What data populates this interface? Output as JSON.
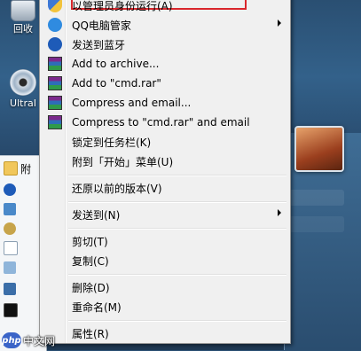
{
  "desktop": {
    "recycle_label": "回收",
    "ultra_label": "UltraI"
  },
  "start_menu": {
    "folder_label": "附"
  },
  "context_menu": {
    "items": [
      {
        "label": "以管理员身份运行(A)",
        "icon": "shield-icon",
        "submenu": false
      },
      {
        "label": "QQ电脑管家",
        "icon": "qq-icon",
        "submenu": true
      },
      {
        "label": "发送到蓝牙",
        "icon": "bluetooth-icon",
        "submenu": false
      },
      {
        "label": "Add to archive...",
        "icon": "winrar-icon",
        "submenu": false
      },
      {
        "label": "Add to \"cmd.rar\"",
        "icon": "winrar-icon",
        "submenu": false
      },
      {
        "label": "Compress and email...",
        "icon": "winrar-icon",
        "submenu": false
      },
      {
        "label": "Compress to \"cmd.rar\" and email",
        "icon": "winrar-icon",
        "submenu": false
      },
      {
        "label": "锁定到任务栏(K)",
        "icon": "",
        "submenu": false
      },
      {
        "label": "附到「开始」菜单(U)",
        "icon": "",
        "submenu": false
      },
      {
        "label": "还原以前的版本(V)",
        "icon": "",
        "submenu": false
      },
      {
        "label": "发送到(N)",
        "icon": "",
        "submenu": true
      },
      {
        "label": "剪切(T)",
        "icon": "",
        "submenu": false
      },
      {
        "label": "复制(C)",
        "icon": "",
        "submenu": false
      },
      {
        "label": "删除(D)",
        "icon": "",
        "submenu": false
      },
      {
        "label": "重命名(M)",
        "icon": "",
        "submenu": false
      },
      {
        "label": "属性(R)",
        "icon": "",
        "submenu": false
      }
    ]
  },
  "watermark": {
    "logo_text": "php",
    "text": "中文网"
  }
}
